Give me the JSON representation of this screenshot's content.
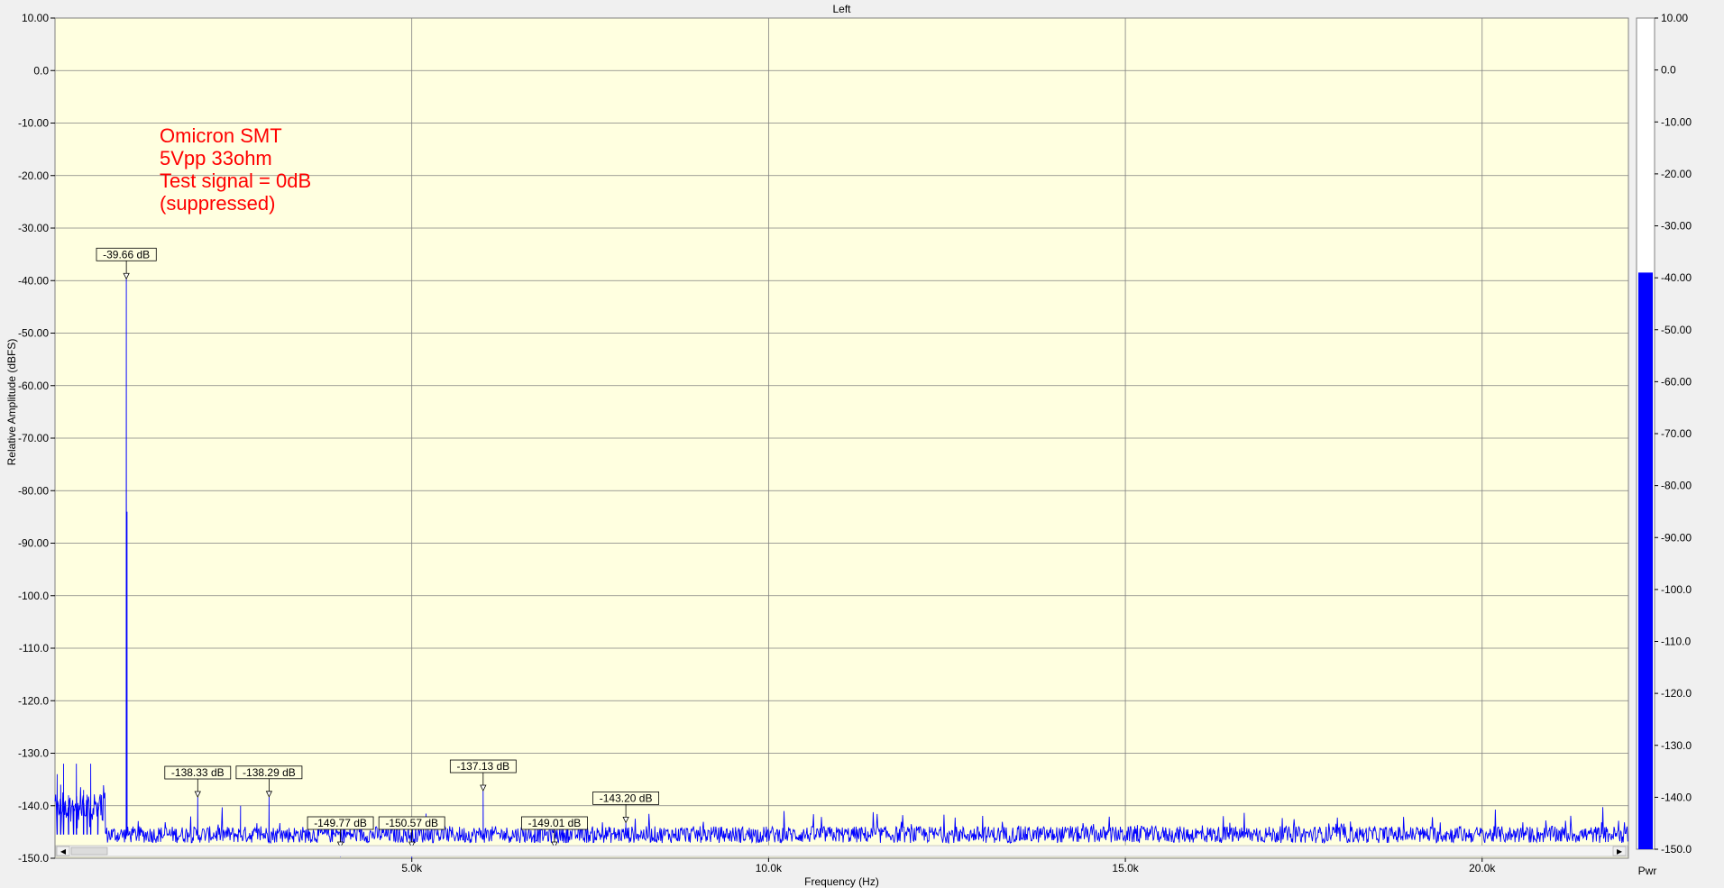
{
  "chart_data": {
    "type": "line",
    "title": "Left",
    "xlabel": "Frequency (Hz)",
    "ylabel": "Relative Amplitude (dBFS)",
    "xlim": [
      0,
      22050
    ],
    "ylim": [
      -150,
      10
    ],
    "x_ticks": [
      5000,
      10000,
      15000,
      20000
    ],
    "x_tick_labels": [
      "5.0k",
      "10.0k",
      "15.0k",
      "20.0k"
    ],
    "y_ticks": [
      10,
      0,
      -10,
      -20,
      -30,
      -40,
      -50,
      -60,
      -70,
      -80,
      -90,
      -100,
      -110,
      -120,
      -130,
      -140,
      -150
    ],
    "y_tick_labels": [
      "10.00",
      "0.0",
      "-10.00",
      "-20.00",
      "-30.00",
      "-40.00",
      "-50.00",
      "-60.00",
      "-70.00",
      "-80.00",
      "-90.00",
      "-100.0",
      "-110.0",
      "-120.0",
      "-130.0",
      "-140.0",
      "-150.0"
    ],
    "grid": true,
    "background_color": "#ffffe0",
    "grid_color": "#808080",
    "series_color": "#0000ff",
    "noise_floor_db": -145.5,
    "fundamental": {
      "x": 1000,
      "y": -39.66
    },
    "spectrum_peaks": [
      {
        "x": 30,
        "y": -134
      },
      {
        "x": 80,
        "y": -136
      },
      {
        "x": 120,
        "y": -132
      },
      {
        "x": 190,
        "y": -138
      },
      {
        "x": 260,
        "y": -140
      },
      {
        "x": 300,
        "y": -132
      },
      {
        "x": 400,
        "y": -137
      },
      {
        "x": 450,
        "y": -140
      },
      {
        "x": 500,
        "y": -132
      },
      {
        "x": 600,
        "y": -141
      },
      {
        "x": 1000,
        "y": -39.66
      },
      {
        "x": 1010,
        "y": -84
      },
      {
        "x": 2000,
        "y": -138.33
      },
      {
        "x": 2600,
        "y": -140
      },
      {
        "x": 3000,
        "y": -138.29
      },
      {
        "x": 4000,
        "y": -149.77
      },
      {
        "x": 5000,
        "y": -150.57
      },
      {
        "x": 5200,
        "y": -141.5
      },
      {
        "x": 6000,
        "y": -137.13
      },
      {
        "x": 7000,
        "y": -149.01
      },
      {
        "x": 8000,
        "y": -143.2
      }
    ],
    "markers": [
      {
        "x": 1000,
        "y": -39.66,
        "label": "-39.66 dB"
      },
      {
        "x": 2000,
        "y": -138.33,
        "label": "-138.33 dB"
      },
      {
        "x": 3000,
        "y": -138.29,
        "label": "-138.29 dB"
      },
      {
        "x": 4000,
        "y": -149.77,
        "label": "-149.77 dB"
      },
      {
        "x": 5000,
        "y": -150.57,
        "label": "-150.57 dB"
      },
      {
        "x": 6000,
        "y": -137.13,
        "label": "-137.13 dB"
      },
      {
        "x": 7000,
        "y": -149.01,
        "label": "-149.01 dB"
      },
      {
        "x": 8000,
        "y": -143.2,
        "label": "-143.20 dB"
      }
    ],
    "annotation": [
      "Omicron SMT",
      "5Vpp 33ohm",
      "Test signal = 0dB",
      "(suppressed)"
    ],
    "annotation_color": "#ff0000",
    "meter": {
      "label": "Pwr",
      "value": -39,
      "ylim": [
        -150,
        10
      ],
      "y_tick_labels": [
        "10.00",
        "0.0",
        "-10.00",
        "-20.00",
        "-30.00",
        "-40.00",
        "-50.00",
        "-60.00",
        "-70.00",
        "-80.00",
        "-90.00",
        "-100.0",
        "-110.0",
        "-120.0",
        "-130.0",
        "-140.0",
        "-150.0"
      ],
      "fill_color": "#0000ff"
    },
    "scrollbar": {
      "left_arrow": "◂",
      "right_arrow": "▸"
    }
  }
}
